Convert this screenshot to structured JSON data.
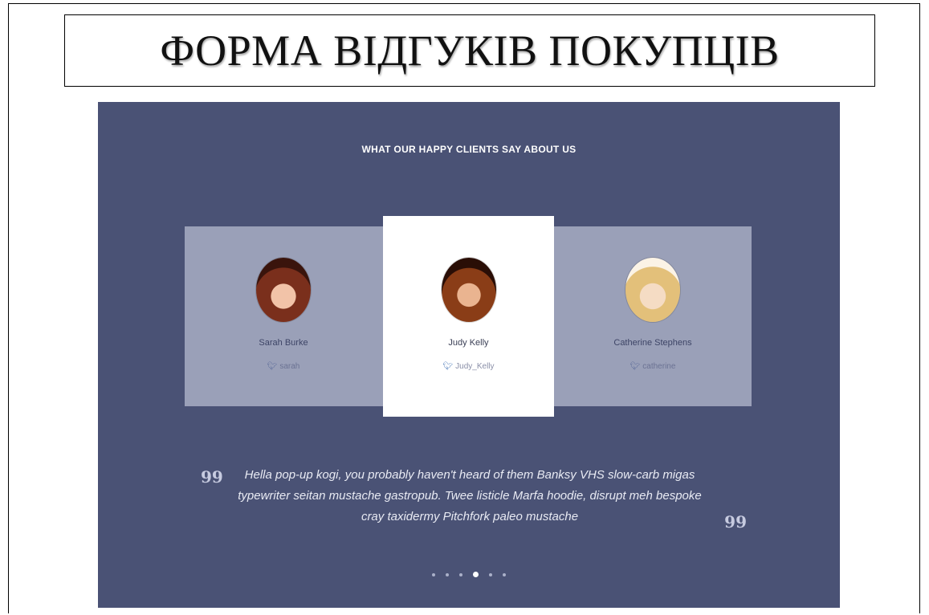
{
  "page_title": "ФОРМА ВІДГУКІВ ПОКУПЦІВ",
  "section_heading": "WHAT OUR HAPPY CLIENTS SAY ABOUT US",
  "testimonials": [
    {
      "name": "Sarah Burke",
      "handle": "sarah"
    },
    {
      "name": "Judy Kelly",
      "handle": "Judy_Kelly"
    },
    {
      "name": "Catherine Stephens",
      "handle": "catherine"
    }
  ],
  "quote": {
    "line1": "Hella pop-up kogi, you probably haven't heard of them Banksy VHS slow-carb migas",
    "line2": "typewriter seitan mustache gastropub. Twee listicle Marfa hoodie, disrupt meh bespoke",
    "line3": "cray taxidermy Pitchfork paleo mustache",
    "open_mark": "99",
    "close_mark": "99"
  },
  "pagination": {
    "total": 6,
    "active": 4
  },
  "icons": {
    "twitter": "twitter-icon",
    "quote": "quote-icon"
  },
  "colors": {
    "panel_bg": "#4a5275",
    "side_cards_bg": "#9aa0b8",
    "active_card_bg": "#ffffff"
  }
}
